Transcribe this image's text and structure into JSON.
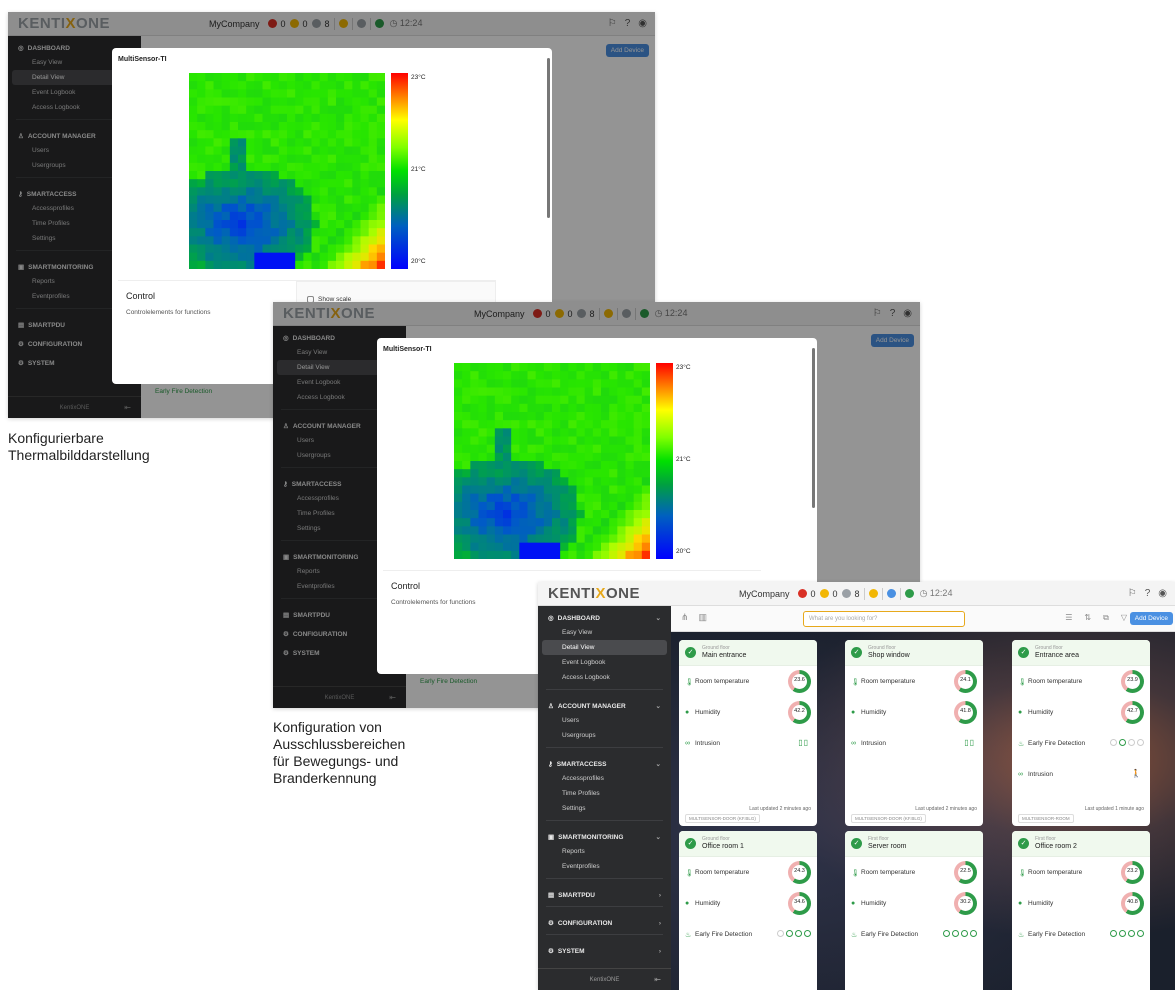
{
  "app": {
    "logo_prefix": "KENTI",
    "logo_x": "X",
    "logo_suffix": "ONE",
    "company": "MyCompany",
    "status_counts": [
      "0",
      "0",
      "8"
    ],
    "time": "12:24",
    "footer": "KentixONE"
  },
  "sidebar": {
    "sections": [
      {
        "label": "DASHBOARD",
        "items": [
          "Easy View",
          "Detail View",
          "Event Logbook",
          "Access Logbook"
        ]
      },
      {
        "label": "ACCOUNT MANAGER",
        "items": [
          "Users",
          "Usergroups"
        ]
      },
      {
        "label": "SMARTACCESS",
        "items": [
          "Accessprofiles",
          "Time Profiles",
          "Settings"
        ]
      },
      {
        "label": "SMARTMONITORING",
        "items": [
          "Reports",
          "Eventprofiles"
        ]
      },
      {
        "label": "SMARTPDU",
        "items": []
      },
      {
        "label": "CONFIGURATION",
        "items": []
      },
      {
        "label": "SYSTEM",
        "items": []
      }
    ]
  },
  "modal": {
    "title": "MultiSensor-TI",
    "scale_max": "23°C",
    "scale_mid": "21°C",
    "scale_min": "20°C",
    "control_title": "Control",
    "control_sub": "Controlelements for functions",
    "show_scale": "Show scale",
    "bg_row": "Early Fire Detection",
    "add_device": "Add Device"
  },
  "captions": {
    "cap1": [
      "Konfigurierbare",
      "Thermalbilddarstellung"
    ],
    "cap2": [
      "Konfiguration von",
      "Ausschlussbereichen",
      "für Bewegungs- und",
      "Branderkennung"
    ]
  },
  "dashboard": {
    "search_placeholder": "What are you looking for?",
    "add_device": "Add Device",
    "cards": [
      {
        "floor": "Ground floor",
        "name": "Main entrance",
        "temp": "23.6",
        "hum": "42.2",
        "third": "Intrusion",
        "updated": "Last updated 2 minutes ago",
        "device": "MULTISENSOR-DOOR (KF.BLG)"
      },
      {
        "floor": "Ground floor",
        "name": "Shop window",
        "temp": "24.1",
        "hum": "41.8",
        "third": "Intrusion",
        "updated": "Last updated 2 minutes ago",
        "device": "MULTISENSOR-DOOR (KF.BLG)"
      },
      {
        "floor": "Ground floor",
        "name": "Entrance area",
        "temp": "23.9",
        "hum": "42.7",
        "third": "Early Fire Detection",
        "fourth": "Intrusion",
        "updated": "Last updated 1 minute ago",
        "device": "MULTISENSOR-ROOM"
      },
      {
        "floor": "Ground floor",
        "name": "Office room 1",
        "temp": "24.3",
        "hum": "34.6",
        "third": "Early Fire Detection"
      },
      {
        "floor": "First floor",
        "name": "Server room",
        "temp": "22.5",
        "hum": "30.2",
        "third": "Early Fire Detection"
      },
      {
        "floor": "First floor",
        "name": "Office room 2",
        "temp": "23.2",
        "hum": "40.8",
        "third": "Early Fire Detection"
      }
    ],
    "labels": {
      "temp": "Room temperature",
      "hum": "Humidity"
    }
  },
  "colors": {
    "accent": "#4a90e2",
    "ok": "#2e9b49",
    "sidebar": "#2b2c2e",
    "logo_x": "#e7a91c"
  }
}
